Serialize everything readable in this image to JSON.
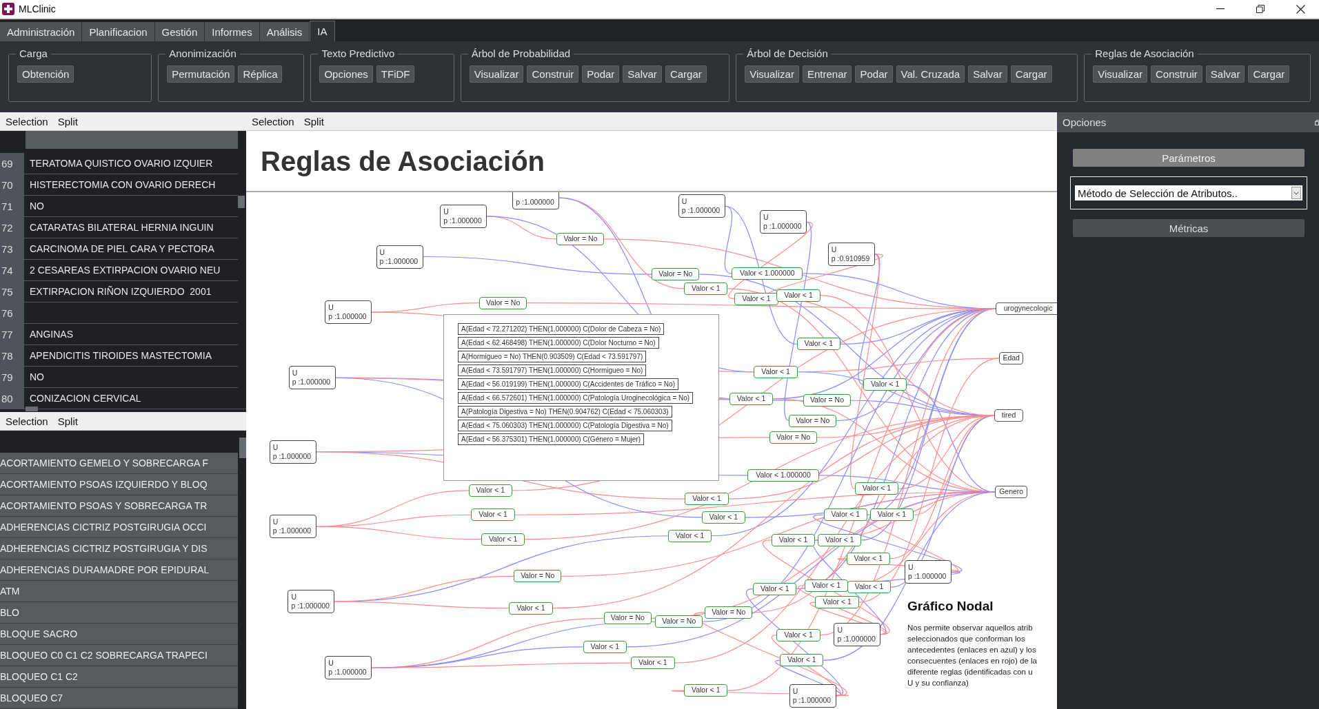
{
  "window": {
    "title": "MLClinic"
  },
  "menu_tabs": [
    {
      "label": "Administración",
      "selected": false
    },
    {
      "label": "Planificacion",
      "selected": false
    },
    {
      "label": "Gestión",
      "selected": false
    },
    {
      "label": "Informes",
      "selected": false
    },
    {
      "label": "Análisis",
      "selected": false
    },
    {
      "label": "IA",
      "selected": true
    }
  ],
  "ribbon_groups": [
    {
      "title": "Carga",
      "buttons": [
        "Obtención"
      ]
    },
    {
      "title": "Anonimización",
      "buttons": [
        "Permutación",
        "Réplica"
      ]
    },
    {
      "title": "Texto Predictivo",
      "buttons": [
        "Opciones",
        "TFiDF"
      ]
    },
    {
      "title": "Árbol de Probabilidad",
      "buttons": [
        "Visualizar",
        "Construir",
        "Podar",
        "Salvar",
        "Cargar"
      ]
    },
    {
      "title": "Árbol de Decisión",
      "buttons": [
        "Visualizar",
        "Entrenar",
        "Podar",
        "Val. Cruzada",
        "Salvar",
        "Cargar"
      ]
    },
    {
      "title": "Reglas de Asociación",
      "buttons": [
        "Visualizar",
        "Construir",
        "Salvar",
        "Cargar"
      ]
    }
  ],
  "left_top_panel": {
    "toolbar": [
      "Selection",
      "Split"
    ],
    "rows": [
      {
        "number": "69",
        "text": "TERATOMA QUISTICO OVARIO IZQUIER"
      },
      {
        "number": "70",
        "text": "HISTERECTOMIA CON OVARIO DERECH"
      },
      {
        "number": "71",
        "text": "NO"
      },
      {
        "number": "72",
        "text": "CATARATAS BILATERAL HERNIA INGUIN"
      },
      {
        "number": "73",
        "text": "CARCINOMA DE PIEL CARA Y PECTORA"
      },
      {
        "number": "74",
        "text": "2 CESAREAS EXTIRPACION OVARIO NEU"
      },
      {
        "number": "75",
        "text": "EXTIRPACION RIÑON IZQUIERDO  2001"
      },
      {
        "number": "76"
      },
      {
        "number": "77",
        "text": "ANGINAS"
      },
      {
        "number": "78",
        "text": "APENDICITIS TIROIDES MASTECTOMIA"
      },
      {
        "number": "79",
        "text": "NO"
      },
      {
        "number": "80",
        "text": "CONIZACION CERVICAL"
      }
    ]
  },
  "left_bottom_panel": {
    "toolbar": [
      "Selection",
      "Split"
    ],
    "rows": [
      "ACORTAMIENTO GEMELO Y SOBRECARGA F",
      "ACORTAMIENTO PSOAS IZQUIERDO Y BLOQ",
      "ACORTAMIENTO PSOAS Y SOBRECARGA TR",
      "ADHERENCIAS CICTRIZ POSTGIRUGIA OCCI",
      "ADHERENCIAS CICTRIZ POSTGIRUGIA Y DIS",
      "ADHERENCIAS DURAMADRE POR EPIDURAL",
      "ATM",
      "BLO",
      "BLOQUE SACRO",
      "BLOQUEO C0 C1 C2 SOBRECARGA TRAPECI",
      "BLOQUEO C1 C2",
      "BLOQUEO C7"
    ]
  },
  "center_panel": {
    "toolbar": [
      "Selection",
      "Split"
    ],
    "title": "Reglas de Asociación",
    "graph": {
      "rule_nodes": [
        {
          "rule": "U",
          "confidence": "p :1.000000"
        },
        {
          "confidence": "p :1.000000"
        },
        {
          "rule": "U",
          "confidence": "p :1.000000"
        },
        {
          "rule": "U",
          "confidence": "p :1.000000"
        },
        {
          "rule": "U",
          "confidence": "p :1.000000"
        },
        {
          "rule": "U",
          "confidence": "p :1.000000"
        },
        {
          "rule": "U",
          "confidence": "p :1.000000"
        },
        {
          "rule": "U",
          "confidence": "p :1.000000"
        },
        {
          "rule": "U",
          "confidence": "p :1.000000"
        },
        {
          "rule": "U",
          "confidence": "p :1.000000"
        },
        {
          "rule": "U",
          "confidence": "p :1.000000"
        },
        {
          "rule": "U",
          "confidence": "p :0.910959"
        },
        {
          "rule": "U",
          "confidence": "p :1.000000"
        },
        {
          "rule": "U",
          "confidence": "p :1.000000"
        },
        {
          "rule": "U",
          "confidence": "p :1.000000"
        }
      ],
      "condition_nodes": [
        "Valor = No",
        "Valor = No",
        "Valor < 1",
        "Valor < 1.000000",
        "Valor < 1",
        "Valor < 1",
        "Valor = No",
        "Valor < 1",
        "Valor < 1",
        "Valor < 1",
        "Valor = No",
        "Valor < 1",
        "Valor = No",
        "Valor = No",
        "Valor < 1.000000",
        "Valor < 1",
        "Valor < 1",
        "Valor < 1",
        "Valor < 1",
        "Valor < 1",
        "Valor < 1",
        "Valor < 1",
        "Valor < 1",
        "Valor < 1",
        "Valor < 1",
        "Valor < 1",
        "Valor < 1",
        "Valor = No",
        "Valor < 1",
        "Valor < 1",
        "Valor < 1",
        "Valor < 1",
        "Valor < 1",
        "Valor = No",
        "Valor = No",
        "Valor = No",
        "Valor < 1",
        "Valor < 1",
        "Valor < 1",
        "Valor < 1",
        "Valor < 1"
      ],
      "attribute_nodes": [
        "urogynecologic",
        "Edad",
        "tired",
        "Genero"
      ],
      "rules_list": [
        "A(Edad < 72.271202) THEN(1.000000) C(Dolor de Cabeza = No)",
        "A(Edad < 62.468498) THEN(1.000000) C(Dolor Nocturno = No)",
        "A(Hormigueo = No) THEN(0.903509) C(Edad < 73.591797)",
        "A(Edad < 73.591797) THEN(1.000000) C(Hormigueo = No)",
        "A(Edad < 56.019199) THEN(1.000000) C(Accidentes de Tráfico = No)",
        "A(Edad < 66.572601) THEN(1.000000) C(Patología Uroginecológica = No)",
        "A(Patología Digestiva = No) THEN(0.904762) C(Edad < 75.060303)",
        "A(Edad < 75.060303) THEN(1.000000) C(Patología Digestiva = No)",
        "A(Edad < 56.375301) THEN(1.000000) C(Género = Mujer)"
      ],
      "legend": {
        "title": "Gráfico Nodal",
        "lines": [
          "Nos permite observar aquellos atrib",
          "seleccionados que conforman los",
          "antecedentes (enlaces en azul) y los",
          "consecuentes (enlaces en rojo) de la",
          "diferente reglas (identificadas con u",
          "U y su confianza)"
        ]
      }
    }
  },
  "options_panel": {
    "title": "Opciones",
    "sections": [
      {
        "kind": "button",
        "label": "Parámetros",
        "expanded": true
      },
      {
        "kind": "select",
        "value": "Método de Selección de Atributos.."
      },
      {
        "kind": "button",
        "label": "Métricas",
        "expanded": false
      }
    ]
  }
}
